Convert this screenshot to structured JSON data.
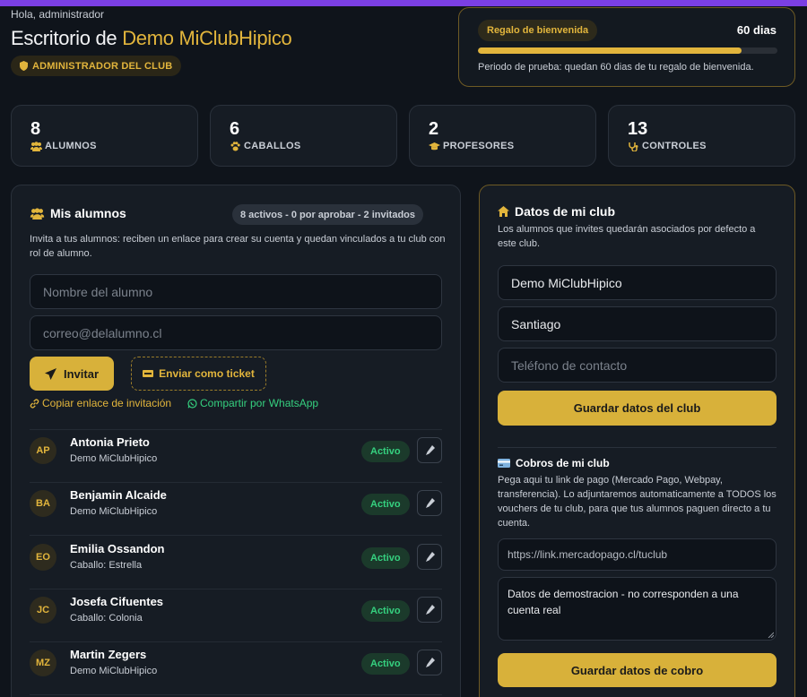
{
  "header": {
    "greeting": "Hola, administrador",
    "title_prefix": "Escritorio de ",
    "club_name": "Demo MiClubHipico",
    "role": "ADMINISTRADOR DEL CLUB"
  },
  "welcome": {
    "badge": "Regalo de bienvenida",
    "days": "60 dias",
    "progress": 0.88,
    "note": "Periodo de prueba: quedan 60 dias de tu regalo de bienvenida."
  },
  "stats": [
    {
      "value": "8",
      "label": "ALUMNOS",
      "icon": "users-icon"
    },
    {
      "value": "6",
      "label": "CABALLOS",
      "icon": "paw-icon"
    },
    {
      "value": "2",
      "label": "PROFESORES",
      "icon": "graduation-cap-icon"
    },
    {
      "value": "13",
      "label": "CONTROLES",
      "icon": "stethoscope-icon"
    }
  ],
  "students": {
    "title": "Mis alumnos",
    "summary": "8 activos - 0 por aprobar - 2 invitados",
    "description": "Invita a tus alumnos: reciben un enlace para crear su cuenta y quedan vinculados a tu club con rol de alumno.",
    "name_placeholder": "Nombre del alumno",
    "email_placeholder": "correo@delalumno.cl",
    "invite_label": "Invitar",
    "ticket_label": "Enviar como ticket",
    "copy_link_label": "Copiar enlace de invitación",
    "whatsapp_label": "Compartir por WhatsApp",
    "list": [
      {
        "initials": "AP",
        "name": "Antonia Prieto",
        "sub": "Demo MiClubHipico",
        "status": "Activo"
      },
      {
        "initials": "BA",
        "name": "Benjamin Alcaide",
        "sub": "Demo MiClubHipico",
        "status": "Activo"
      },
      {
        "initials": "EO",
        "name": "Emilia Ossandon",
        "sub": "Caballo: Estrella",
        "status": "Activo"
      },
      {
        "initials": "JC",
        "name": "Josefa Cifuentes",
        "sub": "Caballo: Colonia",
        "status": "Activo"
      },
      {
        "initials": "MZ",
        "name": "Martin Zegers",
        "sub": "Demo MiClubHipico",
        "status": "Activo"
      }
    ]
  },
  "club": {
    "title": "Datos de mi club",
    "description": "Los alumnos que invites quedarán asociados por defecto a este club.",
    "name_value": "Demo MiClubHipico",
    "city_value": "Santiago",
    "phone_placeholder": "Teléfono de contacto",
    "save_label": "Guardar datos del club",
    "payments_title": "Cobros de mi club",
    "payments_description": "Pega aqui tu link de pago (Mercado Pago, Webpay, transferencia). Lo adjuntaremos automaticamente a TODOS los vouchers de tu club, para que tus alumnos paguen directo a tu cuenta.",
    "link_placeholder": "https://link.mercadopago.cl/tuclub",
    "notes_value": "Datos de demostracion - no corresponden a una cuenta real",
    "save_payments_label": "Guardar datos de cobro"
  },
  "colors": {
    "accent": "#e2b53c",
    "brand": "#7b3fe4",
    "success": "#35d07f"
  }
}
